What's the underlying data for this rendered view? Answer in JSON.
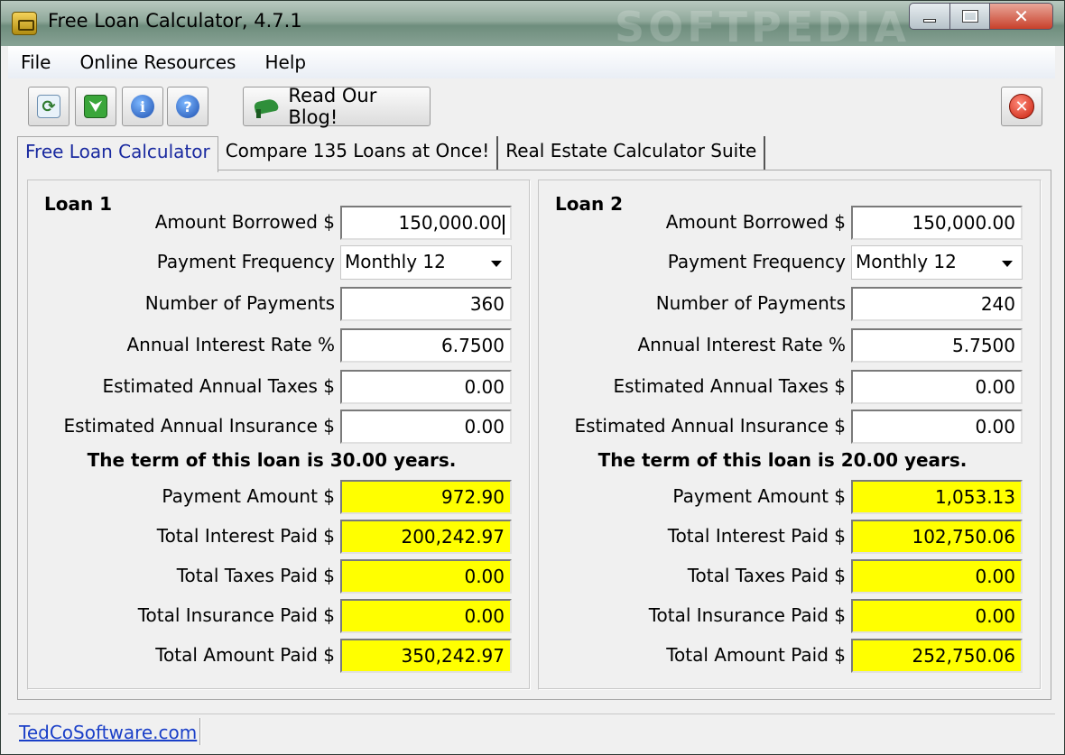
{
  "window": {
    "title": "Free Loan Calculator, 4.7.1",
    "watermark": "SOFTPEDIA",
    "min_label": "",
    "max_label": "",
    "close_label": "✕"
  },
  "menu": {
    "items": [
      "File",
      "Online Resources",
      "Help"
    ]
  },
  "toolbar": {
    "refresh_icon": "refresh-icon",
    "download_icon": "download-icon",
    "info_icon": "info-icon",
    "help_icon": "help-icon",
    "blog_label": "Read Our Blog!",
    "exit_icon": "exit-icon",
    "info_glyph": "i",
    "help_glyph": "?",
    "refresh_glyph": "⟳",
    "download_glyph": "⮟",
    "exit_glyph": "✕"
  },
  "tabs": [
    "Free Loan Calculator",
    "Compare 135 Loans at Once!",
    "Real Estate Calculator Suite"
  ],
  "loans": [
    {
      "title": "Loan 1",
      "amount_borrowed_label": "Amount Borrowed  $",
      "amount_borrowed": "150,000.00",
      "payment_frequency_label": "Payment Frequency",
      "payment_frequency": "Monthly 12",
      "number_of_payments_label": "Number of Payments",
      "number_of_payments": "360",
      "interest_rate_label": "Annual Interest Rate  %",
      "interest_rate": "6.7500",
      "taxes_label": "Estimated Annual Taxes  $",
      "taxes": "0.00",
      "insurance_label": "Estimated Annual Insurance  $",
      "insurance": "0.00",
      "term_text": "The term of this loan is 30.00 years.",
      "payment_amount_label": "Payment Amount  $",
      "payment_amount": "972.90",
      "total_interest_label": "Total Interest Paid  $",
      "total_interest": "200,242.97",
      "total_taxes_label": "Total Taxes Paid  $",
      "total_taxes": "0.00",
      "total_insurance_label": "Total Insurance Paid  $",
      "total_insurance": "0.00",
      "total_amount_label": "Total Amount Paid  $",
      "total_amount": "350,242.97"
    },
    {
      "title": "Loan 2",
      "amount_borrowed_label": "Amount Borrowed  $",
      "amount_borrowed": "150,000.00",
      "payment_frequency_label": "Payment Frequency",
      "payment_frequency": "Monthly 12",
      "number_of_payments_label": "Number of Payments",
      "number_of_payments": "240",
      "interest_rate_label": "Annual Interest Rate  %",
      "interest_rate": "5.7500",
      "taxes_label": "Estimated Annual Taxes  $",
      "taxes": "0.00",
      "insurance_label": "Estimated Annual Insurance  $",
      "insurance": "0.00",
      "term_text": "The term of this loan is 20.00 years.",
      "payment_amount_label": "Payment Amount  $",
      "payment_amount": "1,053.13",
      "total_interest_label": "Total Interest Paid  $",
      "total_interest": "102,750.06",
      "total_taxes_label": "Total Taxes Paid  $",
      "total_taxes": "0.00",
      "total_insurance_label": "Total Insurance Paid  $",
      "total_insurance": "0.00",
      "total_amount_label": "Total Amount Paid  $",
      "total_amount": "252,750.06"
    }
  ],
  "status": {
    "link_text": "TedCoSoftware.com"
  },
  "colors": {
    "output_field": "#ffff00",
    "active_tab_text": "#1a2aa0",
    "link": "#1a3fc8"
  }
}
